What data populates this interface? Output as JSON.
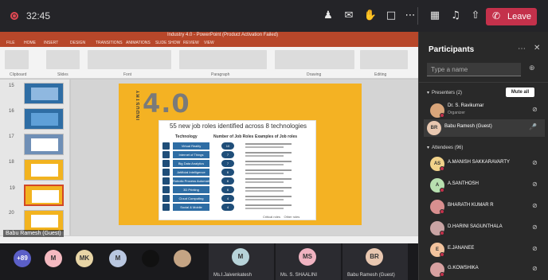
{
  "meeting": {
    "timer": "32:45",
    "leave_label": "Leave",
    "controls": [
      "people-icon",
      "chat-icon",
      "raise-hand-icon",
      "rooms-icon",
      "more-icon",
      "camera-off-icon",
      "mic-off-icon",
      "share-icon"
    ]
  },
  "powerpoint": {
    "title": "Industry 4.0 - PowerPoint (Product Activation Failed)",
    "tabs": [
      "FILE",
      "HOME",
      "INSERT",
      "DESIGN",
      "TRANSITIONS",
      "ANIMATIONS",
      "SLIDE SHOW",
      "REVIEW",
      "VIEW"
    ],
    "ribbon_groups": [
      "Clipboard",
      "Slides",
      "Font",
      "Paragraph",
      "Drawing",
      "Editing"
    ],
    "slide_numbers": [
      "15",
      "16",
      "17",
      "18",
      "19",
      "20"
    ],
    "slide": {
      "side_label": "INDUSTRY",
      "big_title": "4.0",
      "headline": "55 new job roles identified across 8 technologies",
      "headers": [
        "Technology",
        "Number of Job Roles",
        "Examples of Job roles"
      ],
      "rows": [
        {
          "tech": "Virtual Reality",
          "count": "10"
        },
        {
          "tech": "Internet of Things",
          "count": "7"
        },
        {
          "tech": "Big Data Analytics",
          "count": "7"
        },
        {
          "tech": "Artificial Intelligence",
          "count": "6"
        },
        {
          "tech": "Robotic Process Automation",
          "count": "6"
        },
        {
          "tech": "3D Printing",
          "count": "6"
        },
        {
          "tech": "Cloud Computing",
          "count": "4"
        },
        {
          "tech": "Social & Mobile",
          "count": "4"
        }
      ],
      "legend": [
        "Critical roles",
        "Other roles"
      ]
    }
  },
  "presenter_tag": "Babu Ramesh (Guest)",
  "participants": {
    "title": "Participants",
    "search_placeholder": "Type a name",
    "presenters_label": "Presenters (2)",
    "mute_all": "Mute all",
    "attendees_label": "Attendees (96)",
    "presenters": [
      {
        "name": "Dr. S. Ravikumar",
        "role": "Organizer",
        "initials": "",
        "color": "#d9a57a",
        "mic": "mic-off-icon"
      },
      {
        "name": "Babu Ramesh (Guest)",
        "role": "",
        "initials": "BR",
        "color": "#e8c7b0",
        "mic": "mic-on-icon"
      }
    ],
    "attendees": [
      {
        "name": "A.MANISH SAKKARAVARTY",
        "initials": "AS",
        "color": "#f1d28a"
      },
      {
        "name": "A.SANTHOSH",
        "initials": "A",
        "color": "#b8e0b0"
      },
      {
        "name": "BHARATH KUMAR R",
        "initials": "",
        "color": "#d88f8f"
      },
      {
        "name": "D.HARINI SAGUNTHALA",
        "initials": "",
        "color": "#c9a4a4"
      },
      {
        "name": "E.JANANEE",
        "initials": "E",
        "color": "#f2c39d"
      },
      {
        "name": "G.KOWSHIKA",
        "initials": "",
        "color": "#d7a0a0"
      }
    ]
  },
  "gallery": {
    "overflow": "+89",
    "avatars": [
      {
        "initials": "M",
        "color": "#f4b9c0"
      },
      {
        "initials": "MK",
        "color": "#e8d5a6"
      },
      {
        "initials": "M",
        "color": "#b9c7e0"
      },
      {
        "initials": "",
        "color": "#111111"
      },
      {
        "initials": "",
        "color": "#c4a484"
      }
    ],
    "tiles": [
      {
        "name": "Ms.I.Jaivenkatesh",
        "initials": "M",
        "color": "#b7d3d9"
      },
      {
        "name": "Ms. S. SHAALINI",
        "initials": "MS",
        "color": "#f0b3c1"
      },
      {
        "name": "Babu Ramesh (Guest)",
        "initials": "BR",
        "color": "#e8c7b0"
      }
    ]
  }
}
